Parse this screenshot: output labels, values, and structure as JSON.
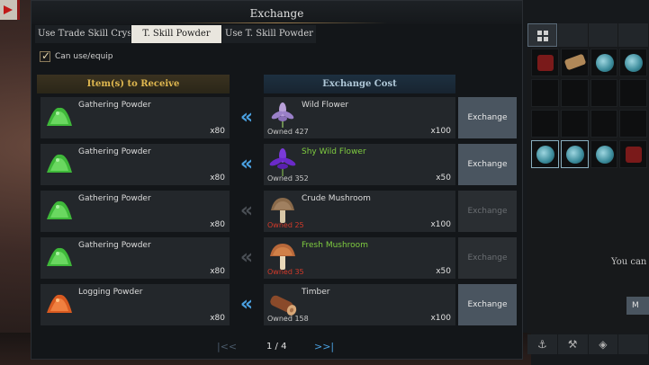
{
  "window": {
    "title": "Exchange"
  },
  "tabs": [
    {
      "label": "Use Trade Skill Crys",
      "selected": false
    },
    {
      "label": "T. Skill Powder",
      "selected": true
    },
    {
      "label": "Use T. Skill Powder",
      "selected": false
    }
  ],
  "filter": {
    "label": "Can use/equip",
    "checked": true
  },
  "headers": {
    "receive": "Item(s) to Receive",
    "cost": "Exchange Cost"
  },
  "rows": [
    {
      "receive": {
        "name": "Gathering Powder",
        "qty": "x80",
        "icon": "green-powder-icon"
      },
      "cost": {
        "name": "Wild Flower",
        "name_color": "#dcdcdc",
        "owned": "Owned 427",
        "owned_insufficient": false,
        "qty": "x100",
        "icon": "wild-flower-icon"
      },
      "arrow_active": true,
      "button": {
        "label": "Exchange",
        "enabled": true
      }
    },
    {
      "receive": {
        "name": "Gathering Powder",
        "qty": "x80",
        "icon": "green-powder-icon"
      },
      "cost": {
        "name": "Shy Wild Flower",
        "name_color": "#7fcc40",
        "owned": "Owned 352",
        "owned_insufficient": false,
        "qty": "x50",
        "icon": "shy-wild-flower-icon"
      },
      "arrow_active": true,
      "button": {
        "label": "Exchange",
        "enabled": true
      }
    },
    {
      "receive": {
        "name": "Gathering Powder",
        "qty": "x80",
        "icon": "green-powder-icon"
      },
      "cost": {
        "name": "Crude Mushroom",
        "name_color": "#dcdcdc",
        "owned": "Owned 25",
        "owned_insufficient": true,
        "qty": "x100",
        "icon": "crude-mushroom-icon"
      },
      "arrow_active": false,
      "button": {
        "label": "Exchange",
        "enabled": false
      }
    },
    {
      "receive": {
        "name": "Gathering Powder",
        "qty": "x80",
        "icon": "green-powder-icon"
      },
      "cost": {
        "name": "Fresh Mushroom",
        "name_color": "#7fcc40",
        "owned": "Owned 35",
        "owned_insufficient": true,
        "qty": "x50",
        "icon": "fresh-mushroom-icon"
      },
      "arrow_active": false,
      "button": {
        "label": "Exchange",
        "enabled": false
      }
    },
    {
      "receive": {
        "name": "Logging Powder",
        "qty": "x80",
        "icon": "orange-powder-icon"
      },
      "cost": {
        "name": "Timber",
        "name_color": "#dcdcdc",
        "owned": "Owned 158",
        "owned_insufficient": false,
        "qty": "x100",
        "icon": "timber-icon"
      },
      "arrow_active": true,
      "button": {
        "label": "Exchange",
        "enabled": true
      }
    }
  ],
  "pagination": {
    "text": "1 / 4",
    "current": 1,
    "total": 4
  },
  "inventory": {
    "message": "You can",
    "button_label": "M"
  },
  "colors": {
    "accent": "#4aa0e0",
    "receive_header": "#e0b850",
    "insufficient": "#d43a2a",
    "rare_item": "#7fcc40"
  }
}
